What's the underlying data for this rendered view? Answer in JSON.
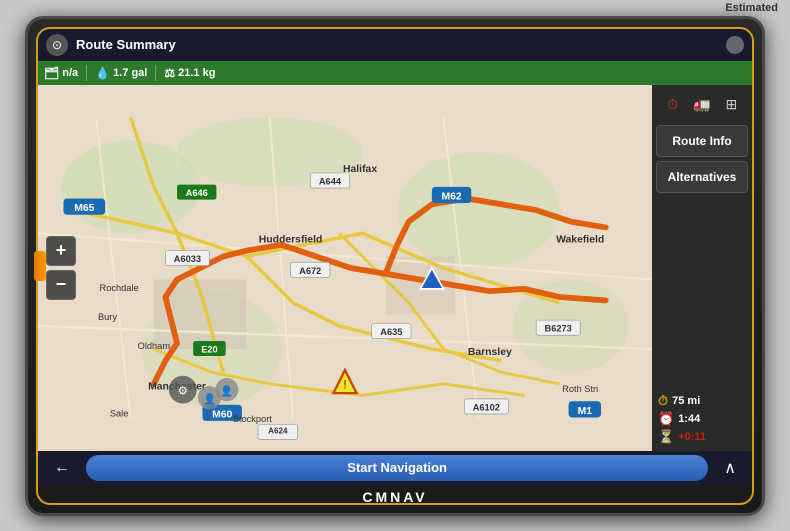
{
  "estimated_label": "Estimated",
  "device": {
    "brand": "CMNAV"
  },
  "top_bar": {
    "title": "Route Summary",
    "icon": "⊙"
  },
  "stats_bar": {
    "items": [
      {
        "icon": "🗂",
        "value": "n/a"
      },
      {
        "icon": "💧",
        "value": "1.7 gal"
      },
      {
        "icon": "⚖",
        "value": "21.1 kg"
      }
    ]
  },
  "right_sidebar": {
    "route_info_label": "Route Info",
    "alternatives_label": "Alternatives",
    "stats": [
      {
        "icon": "hourglass",
        "value": "75 mi",
        "color": "#cc9900"
      },
      {
        "icon": "clock",
        "value": "1:44",
        "color": "#cc9900"
      },
      {
        "icon": "hourglass-red",
        "value": "+0:11",
        "color": "#cc2200"
      }
    ]
  },
  "bottom_bar": {
    "back_label": "←",
    "start_nav_label": "Start Navigation",
    "chevron_up_label": "∧"
  },
  "map": {
    "road_labels": [
      "M65",
      "A646",
      "A644",
      "Halifax",
      "M62",
      "Wakefield",
      "A6033",
      "Huddersfield",
      "A672",
      "Rochdale",
      "Bury",
      "E20",
      "Oldham",
      "A635",
      "Barnsley",
      "B6273",
      "Manchester",
      "M60",
      "Sale",
      "Stockport",
      "A624",
      "A6102",
      "Roth Stn",
      "M1"
    ]
  }
}
